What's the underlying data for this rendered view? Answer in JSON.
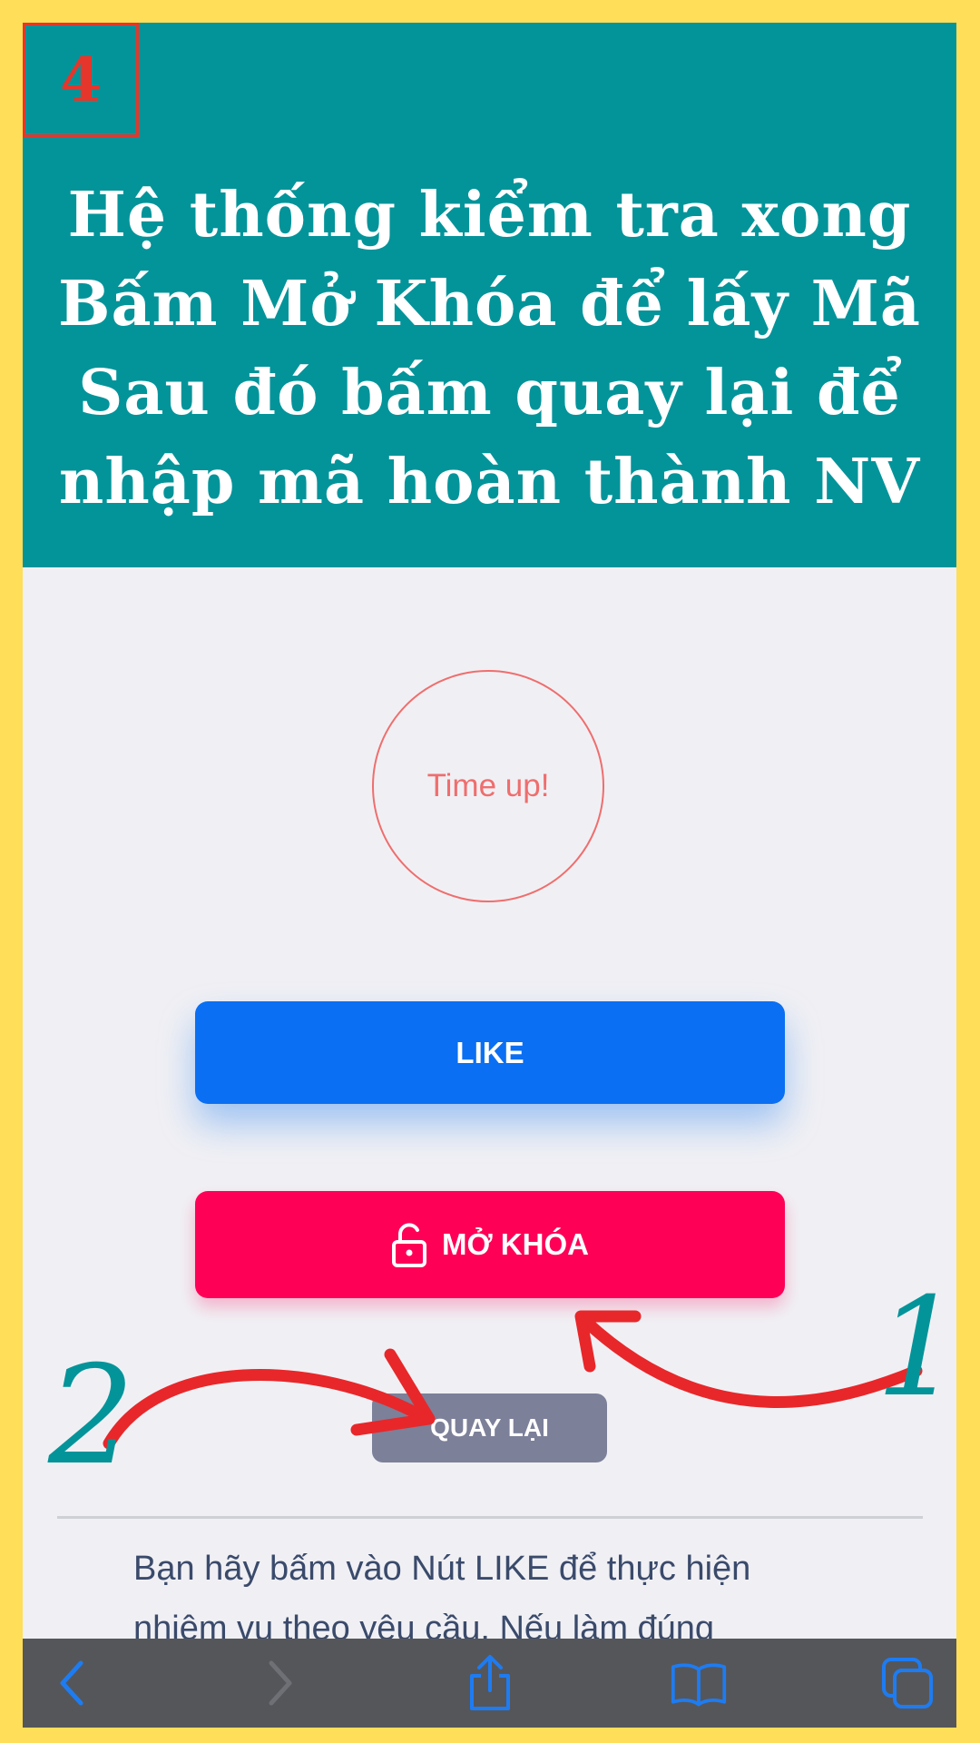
{
  "step_number": "4",
  "headline": [
    "Hệ thống kiểm tra xong",
    "Bấm Mở Khóa để lấy Mã",
    "Sau đó bấm quay lại để",
    "nhập mã hoàn thành NV"
  ],
  "timer": {
    "text": "Time up!"
  },
  "buttons": {
    "like": "LIKE",
    "unlock": "MỞ KHÓA",
    "back": "QUAY LẠI"
  },
  "annotations": {
    "one": "1",
    "two": "2"
  },
  "description": {
    "line1": "Bạn hãy bấm vào Nút LIKE để thực hiện",
    "line2": "nhiệm vụ theo yêu cầu. Nếu làm đúng"
  },
  "toolbar": {
    "icons": [
      "back-icon",
      "forward-icon",
      "share-icon",
      "bookmarks-icon",
      "tabs-icon"
    ]
  },
  "colors": {
    "page_border": "#FFDE59",
    "banner": "#03949A",
    "like_button": "#0A6FF2",
    "unlock_button": "#FE0157",
    "back_button": "#7C8099",
    "arrow": "#E8272A",
    "timer": "#EF6E6E",
    "browser_icons": "#1E7CF2"
  }
}
